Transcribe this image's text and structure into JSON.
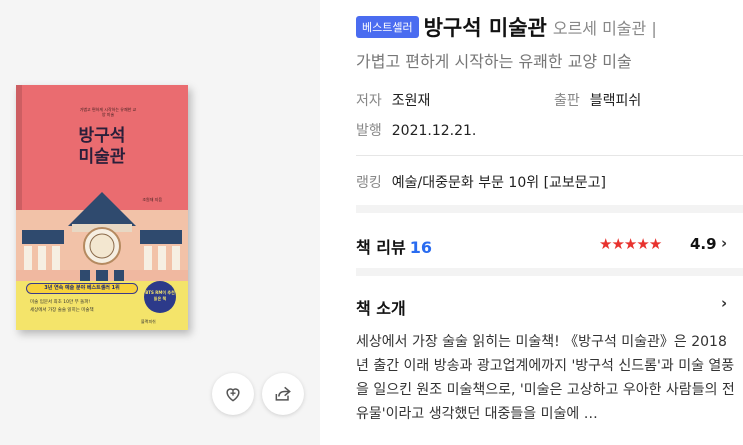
{
  "book": {
    "cover": {
      "tagline": "가볍고 편하게 시작하는 유쾌한 교양 미술",
      "title_line1": "방구석",
      "title_line2": "미술관",
      "author": "조원재 지음",
      "award": "3년 연속 예술 분야 베스트셀러 1위",
      "circle": "BTS RM이 추천 읽은 책",
      "band_line1": "미술 입문서 최초 10만 부 돌파!",
      "band_line2": "세상에서 가장 술술 읽히는 미술책",
      "publisher_mark": "블랙피쉬"
    },
    "badge": "베스트셀러",
    "title": "방구석 미술관",
    "subtitle_part1": "오르세 미술관 |",
    "subtitle_part2": "가볍고 편하게 시작하는 유쾌한 교양 미술",
    "author_label": "저자",
    "author": "조원재",
    "publisher_label": "출판",
    "publisher": "블랙피쉬",
    "date_label": "발행",
    "date": "2021.12.21.",
    "ranking_label": "랭킹",
    "ranking": "예술/대중문화 부문 10위 [교보문고]"
  },
  "reviews": {
    "title": "책 리뷰",
    "count": "16",
    "rating": "4.9",
    "stars": 5
  },
  "intro": {
    "title": "책 소개",
    "text": "세상에서 가장 술술 읽히는 미술책! 《방구석 미술관》은 2018년 출간 이래 방송과 광고업계에까지 '방구석 신드롬'과 미술 열풍을 일으킨 원조 미술책으로, '미술은 고상하고 우아한 사람들의 전유물'이라고 생각했던 대중들을 미술에 …"
  },
  "icons": {
    "like": "heart-plus-icon",
    "share": "share-icon",
    "chevron": "chevron-right-icon"
  },
  "colors": {
    "badge": "#4a6cf0",
    "stars": "#e8322e",
    "review_count": "#2a6cf0"
  }
}
